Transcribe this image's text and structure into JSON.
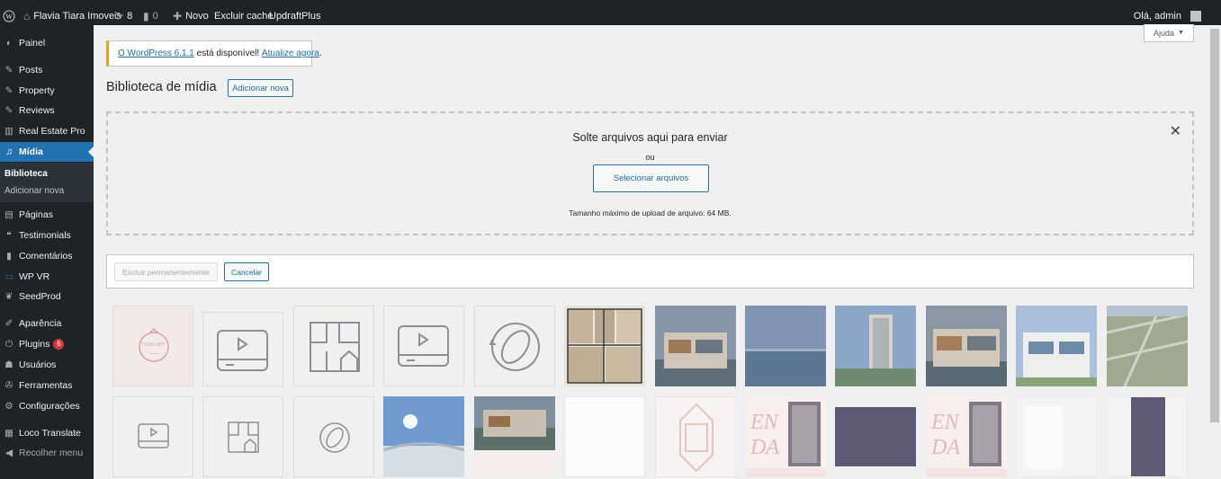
{
  "adminbar": {
    "site_name": "Flavia Tiara Imoveis",
    "updates_count": "8",
    "comments_count": "0",
    "new_label": "Novo",
    "cache_label": "Excluir cache",
    "updraft_label": "UpdraftPlus",
    "greeting": "Olá, admin"
  },
  "sidebar": {
    "items": [
      {
        "label": "Painel",
        "icon": "dashboard-icon"
      },
      {
        "label": "Posts",
        "icon": "pin-icon"
      },
      {
        "label": "Property",
        "icon": "pin-icon"
      },
      {
        "label": "Reviews",
        "icon": "pin-icon"
      },
      {
        "label": "Real Estate Pro",
        "icon": "building-icon"
      },
      {
        "label": "Mídia",
        "icon": "media-icon"
      },
      {
        "label": "Páginas",
        "icon": "page-icon"
      },
      {
        "label": "Testimonials",
        "icon": "quote-icon"
      },
      {
        "label": "Comentários",
        "icon": "comment-icon"
      },
      {
        "label": "WP VR",
        "icon": "vr-icon"
      },
      {
        "label": "SeedProd",
        "icon": "seed-icon"
      },
      {
        "label": "Aparência",
        "icon": "brush-icon"
      },
      {
        "label": "Plugins",
        "icon": "plugin-icon",
        "badge": "6"
      },
      {
        "label": "Usuários",
        "icon": "user-icon"
      },
      {
        "label": "Ferramentas",
        "icon": "wrench-icon"
      },
      {
        "label": "Configurações",
        "icon": "settings-icon"
      },
      {
        "label": "Loco Translate",
        "icon": "translate-icon"
      },
      {
        "label": "Recolher menu",
        "icon": "collapse-icon"
      }
    ],
    "submenu": [
      "Biblioteca",
      "Adicionar nova"
    ]
  },
  "help_label": "Ajuda",
  "notice": {
    "link1": "O WordPress 6.1.1",
    "text": "está disponível!",
    "link2": "Atualize agora",
    "end": "."
  },
  "page": {
    "title": "Biblioteca de mídia",
    "add_new": "Adicionar nova"
  },
  "uploader": {
    "title": "Solte arquivos aqui para enviar",
    "or": "ou",
    "select_button": "Selecionar arquivos",
    "max_size": "Tamanho máximo de upload de arquivo: 64 MB."
  },
  "bulk": {
    "delete_label": "Excluir permanentemente",
    "cancel_label": "Cancelar"
  },
  "tour_label": "TOUR 360°",
  "colors": {
    "admin_bg": "#1d2327",
    "accent": "#2271b1",
    "notice_border": "#dba617",
    "badge": "#d63638"
  }
}
